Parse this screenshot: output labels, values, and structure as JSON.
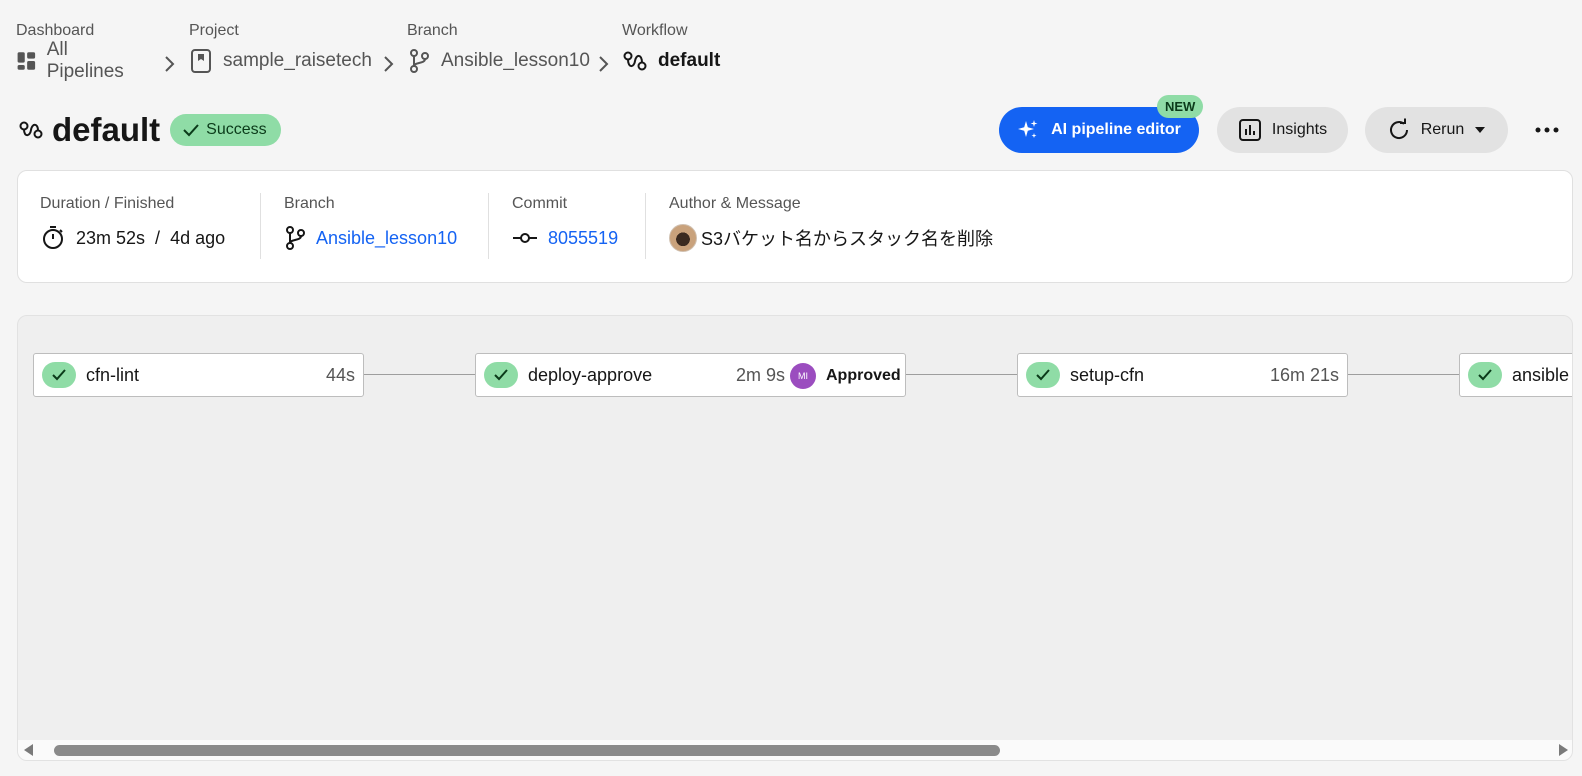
{
  "breadcrumb": {
    "dashboard": {
      "label": "Dashboard",
      "value": "All Pipelines",
      "icon": "dashboard-grid-icon"
    },
    "project": {
      "label": "Project",
      "value": "sample_raisetech",
      "icon": "project-bookmark-icon"
    },
    "branch": {
      "label": "Branch",
      "value": "Ansible_lesson10",
      "icon": "branch-icon"
    },
    "workflow": {
      "label": "Workflow",
      "value": "default",
      "icon": "workflow-icon"
    }
  },
  "header": {
    "title": "default",
    "status": "Success",
    "ai_button": "AI pipeline editor",
    "new_badge": "NEW",
    "insights_button": "Insights",
    "rerun_button": "Rerun"
  },
  "info": {
    "duration_label": "Duration / Finished",
    "duration": "23m 52s",
    "separator": "/",
    "finished": "4d ago",
    "branch_label": "Branch",
    "branch": "Ansible_lesson10",
    "commit_label": "Commit",
    "commit": "8055519",
    "author_label": "Author & Message",
    "message": "S3バケット名からスタック名を削除"
  },
  "jobs": [
    {
      "name": "cfn-lint",
      "duration": "44s",
      "status": "success"
    },
    {
      "name": "deploy-approve",
      "duration": "2m 9s",
      "status": "success",
      "approver_initials": "MI",
      "approval": "Approved"
    },
    {
      "name": "setup-cfn",
      "duration": "16m 21s",
      "status": "success"
    },
    {
      "name": "ansible",
      "duration": "",
      "status": "success"
    }
  ],
  "colors": {
    "accent": "#1463f3",
    "success": "#8fdca6",
    "approver": "#9b4dbf"
  }
}
